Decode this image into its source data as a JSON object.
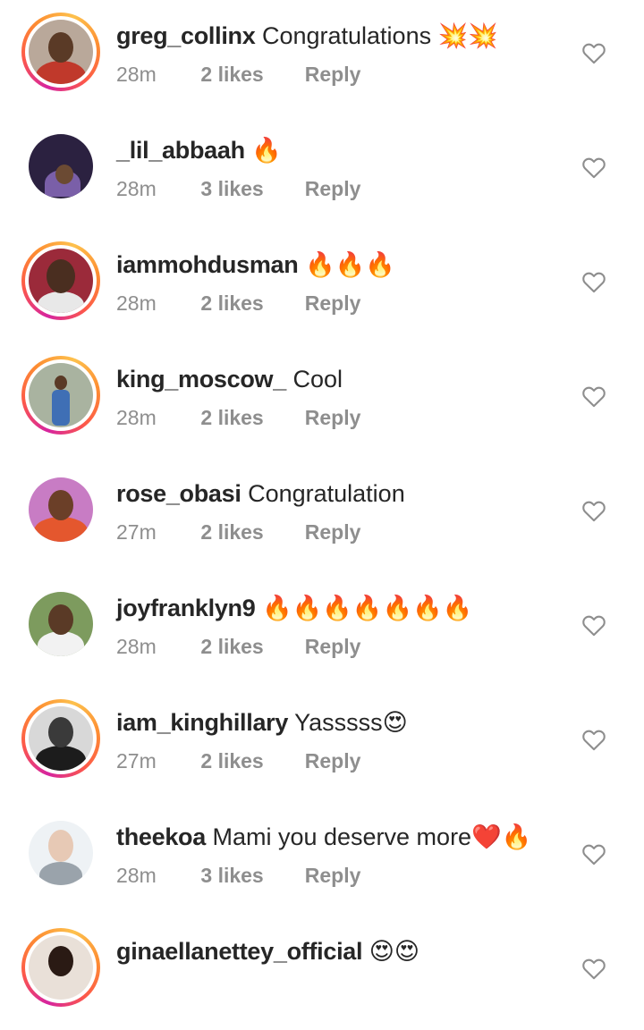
{
  "comments": [
    {
      "username": "greg_collinx",
      "text": "Congratulations 💥💥",
      "time": "28m",
      "likes": "2 likes",
      "reply": "Reply",
      "story_ring": true
    },
    {
      "username": "_lil_abbaah",
      "text": "🔥",
      "time": "28m",
      "likes": "3 likes",
      "reply": "Reply",
      "story_ring": false
    },
    {
      "username": "iammohdusman",
      "text": "🔥🔥🔥",
      "time": "28m",
      "likes": "2 likes",
      "reply": "Reply",
      "story_ring": true
    },
    {
      "username": "king_moscow_",
      "text": "Cool",
      "time": "28m",
      "likes": "2 likes",
      "reply": "Reply",
      "story_ring": true
    },
    {
      "username": "rose_obasi",
      "text": "Congratulation",
      "time": "27m",
      "likes": "2 likes",
      "reply": "Reply",
      "story_ring": false
    },
    {
      "username": "joyfranklyn9",
      "text": "🔥🔥🔥🔥🔥🔥🔥",
      "time": "28m",
      "likes": "2 likes",
      "reply": "Reply",
      "story_ring": false
    },
    {
      "username": "iam_kinghillary",
      "text": "Yasssss😍",
      "time": "27m",
      "likes": "2 likes",
      "reply": "Reply",
      "story_ring": true
    },
    {
      "username": "theekoa",
      "text": "Mami you deserve more❤️🔥",
      "time": "28m",
      "likes": "3 likes",
      "reply": "Reply",
      "story_ring": false
    },
    {
      "username": "ginaellanettey_official",
      "text": "😍😍",
      "time": "",
      "likes": "",
      "reply": "",
      "story_ring": true
    }
  ],
  "icons": {
    "like": "heart-outline-icon"
  },
  "colors": {
    "username": "#262626",
    "meta": "#8e8e8e",
    "heart_stroke": "#8e8e8e",
    "story_ring_start": "#d6249f",
    "story_ring_end": "#fdc14d"
  }
}
